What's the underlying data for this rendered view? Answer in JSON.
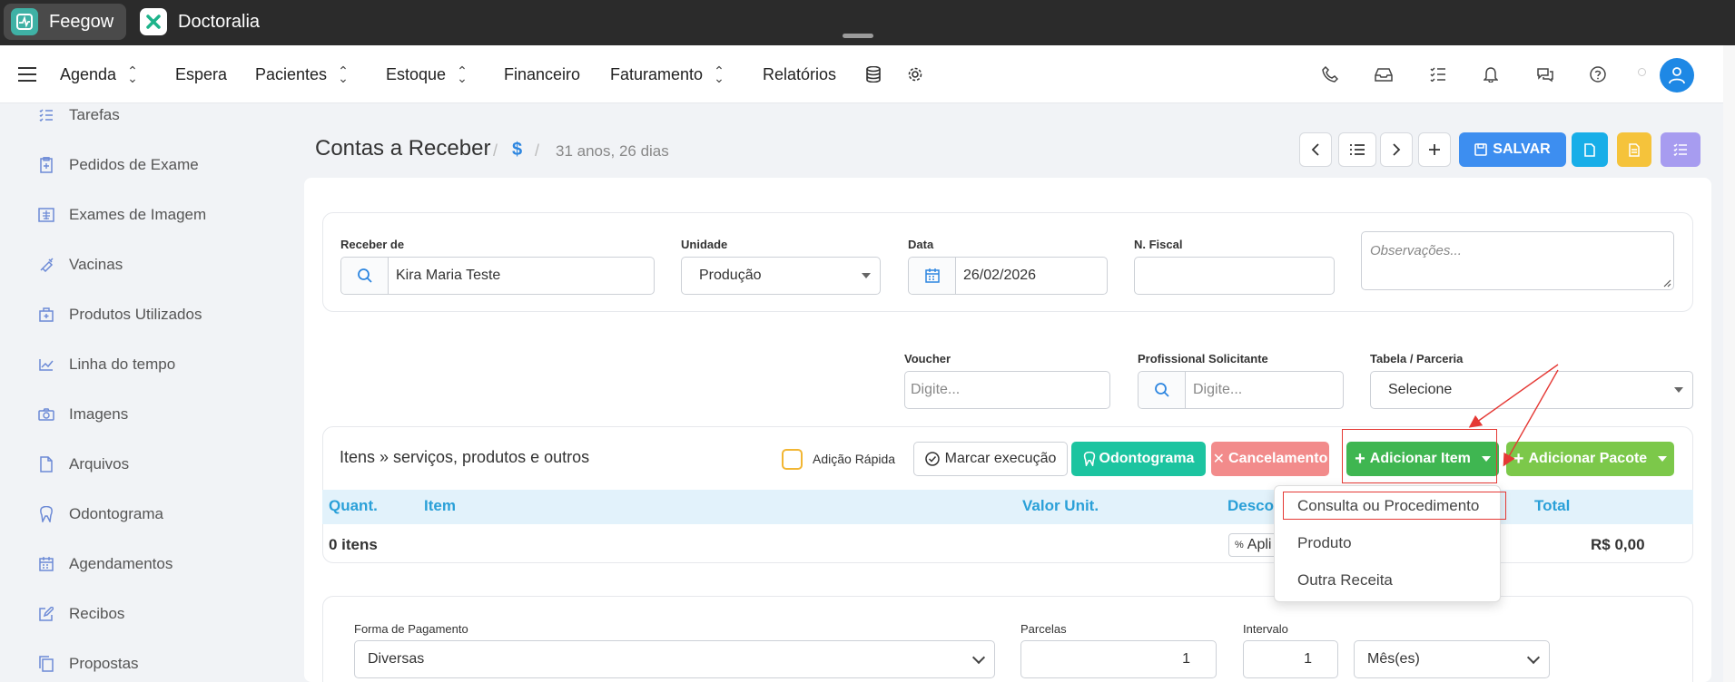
{
  "tabs": [
    {
      "label": "Feegow",
      "logo_color": "#3fb1a5"
    },
    {
      "label": "Doctoralia",
      "logo_color": "#ffffff"
    }
  ],
  "nav": {
    "items": [
      "Agenda",
      "Espera",
      "Pacientes",
      "Estoque",
      "Financeiro",
      "Faturamento",
      "Relatórios"
    ],
    "icons": [
      "database-icon",
      "gear-icon",
      "phone-icon",
      "inbox-icon",
      "tasks-icon",
      "bell-icon",
      "chat-icon",
      "help-icon",
      "user-icon"
    ]
  },
  "sidebar": {
    "items": [
      {
        "label": "Tarefas",
        "icon": "tasks-icon"
      },
      {
        "label": "Pedidos de Exame",
        "icon": "clipboard-icon"
      },
      {
        "label": "Exames de Imagem",
        "icon": "xray-icon"
      },
      {
        "label": "Vacinas",
        "icon": "syringe-icon"
      },
      {
        "label": "Produtos Utilizados",
        "icon": "box-icon"
      },
      {
        "label": "Linha do tempo",
        "icon": "chart-line-icon"
      },
      {
        "label": "Imagens",
        "icon": "camera-icon"
      },
      {
        "label": "Arquivos",
        "icon": "file-icon"
      },
      {
        "label": "Odontograma",
        "icon": "tooth-icon"
      },
      {
        "label": "Agendamentos",
        "icon": "calendar-icon"
      },
      {
        "label": "Recibos",
        "icon": "edit-icon"
      },
      {
        "label": "Propostas",
        "icon": "copy-icon"
      }
    ]
  },
  "header": {
    "title": "Contas a Receber",
    "dollar": "$",
    "age": "31 anos, 26 dias",
    "save_label": "SALVAR"
  },
  "form": {
    "receber_de": {
      "label": "Receber de",
      "value": "Kira Maria Teste"
    },
    "unidade": {
      "label": "Unidade",
      "value": "Produção"
    },
    "data": {
      "label": "Data",
      "value": "26/02/2026"
    },
    "fiscal": {
      "label": "N. Fiscal",
      "value": ""
    },
    "observacoes": {
      "placeholder": "Observações..."
    },
    "voucher": {
      "label": "Voucher",
      "placeholder": "Digite..."
    },
    "profissional": {
      "label": "Profissional Solicitante",
      "placeholder": "Digite..."
    },
    "tabela": {
      "label": "Tabela / Parceria",
      "value": "Selecione"
    }
  },
  "items": {
    "title": "Itens » serviços, produtos e outros",
    "adicao_rapida": "Adição Rápida",
    "btn_marcar": "Marcar execução",
    "btn_odonto": "Odontograma",
    "btn_cancel": "Cancelamento",
    "btn_add_item": "Adicionar Item",
    "btn_add_pacote": "Adicionar Pacote",
    "columns": [
      "Quant.",
      "Item",
      "Valor Unit.",
      "Desco",
      "Total"
    ],
    "count": "0 itens",
    "apply": "Apli",
    "total": "R$ 0,00",
    "dropdown": [
      "Consulta ou Procedimento",
      "Produto",
      "Outra Receita"
    ]
  },
  "payment": {
    "forma": {
      "label": "Forma de Pagamento",
      "value": "Diversas"
    },
    "parcelas": {
      "label": "Parcelas",
      "value": "1"
    },
    "intervalo": {
      "label": "Intervalo",
      "value": "1"
    },
    "periodo": {
      "value": "Mês(es)"
    }
  },
  "colors": {
    "primary": "#3d8ef0",
    "success": "#3fb651",
    "teal": "#1cc4a0",
    "danger": "#f28b8b",
    "annotation": "#e53935"
  }
}
